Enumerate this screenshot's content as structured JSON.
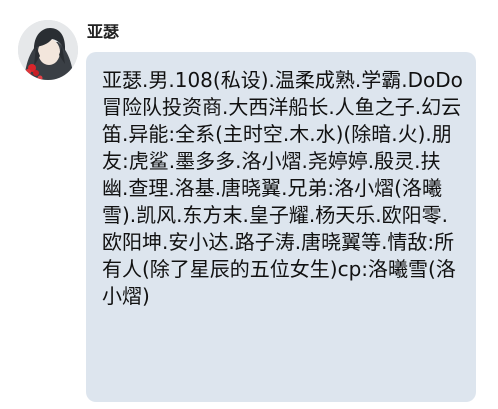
{
  "chat": {
    "sender": {
      "name": "亚瑟",
      "avatar_icon": "anime-character-avatar-icon"
    },
    "message": {
      "text": "亚瑟.男.108(私设).温柔成熟.学霸.DoDo冒险队投资商.大西洋船长.人鱼之子.幻云笛.异能:全系(主时空.木.水)(除暗.火).朋友:虎鲨.墨多多.洛小熠.尧婷婷.殷灵.扶幽.查理.洛基.唐晓翼.兄弟:洛小熠(洛曦雪).凯风.东方末.皇子耀.杨天乐.欧阳零.欧阳坤.安小达.路子涛.唐晓翼等.情敌:所有人(除了星辰的五位女生)cp:洛曦雪(洛小熠)",
      "bubble_color": "#dde5ee"
    }
  }
}
